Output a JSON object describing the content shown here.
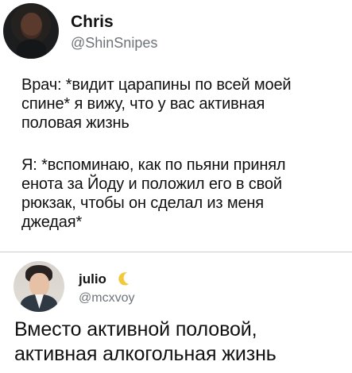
{
  "tweets": [
    {
      "author": {
        "name": "Chris",
        "handle": "@ShinSnipes",
        "avatar": "person-dark-hoodie-avatar"
      },
      "text": {
        "paragraph_1": "Врач: *видит царапины по всей моей\nспине* я вижу, что у вас активная\nполовая жизнь",
        "paragraph_2": "Я: *вспоминаю, как по пьяни принял\nенота за Йоду и положил его в свой\nрюкзак, чтобы он сделал из меня\nджедая*"
      }
    },
    {
      "author": {
        "name": "julio",
        "handle": "@mcxvoy",
        "avatar": "person-suit-avatar",
        "decoration_icon": "crescent-moon-icon"
      },
      "text": "Вместо активной половой,\nактивная алкогольная жизнь"
    }
  ],
  "colors": {
    "background": "#ffffff",
    "text": "#111111",
    "secondary_text": "#6d7378",
    "separator": "#c9cdd1",
    "moon_accent": "#f1c93b"
  }
}
